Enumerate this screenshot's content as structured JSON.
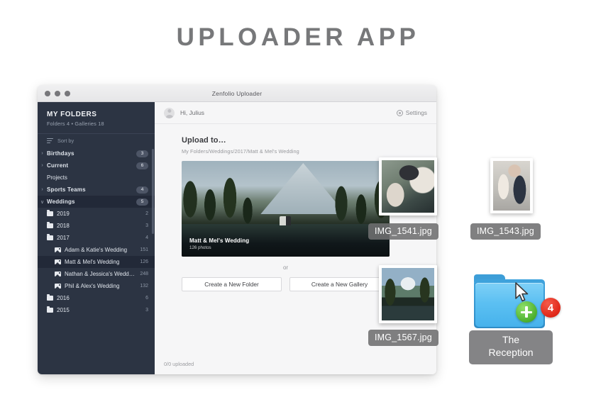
{
  "page": {
    "title": "UPLOADER APP"
  },
  "window": {
    "title": "Zenfolio Uploader",
    "traffic_lights": [
      "close-dot",
      "minimize-dot",
      "zoom-dot"
    ]
  },
  "sidebar": {
    "heading": "MY FOLDERS",
    "subheading": "Folders 4  •  Galleries 18",
    "sort_label": "Sort by",
    "tree": [
      {
        "label": "Birthdays",
        "count": "3",
        "type": "group",
        "expander": "›",
        "indent": 0,
        "selected": false,
        "clipped": true
      },
      {
        "label": "Current Projects",
        "count": "6",
        "type": "group",
        "expander": "›",
        "indent": 0,
        "selected": false
      },
      {
        "label": "Sports Teams",
        "count": "4",
        "type": "group",
        "expander": "›",
        "indent": 0,
        "selected": false
      },
      {
        "label": "Weddings",
        "count": "5",
        "type": "group",
        "expander": "∨",
        "indent": 0,
        "selected": true
      },
      {
        "label": "2019",
        "count": "2",
        "type": "folder",
        "indent": 1,
        "selected": false
      },
      {
        "label": "2018",
        "count": "3",
        "type": "folder",
        "indent": 1,
        "selected": false
      },
      {
        "label": "2017",
        "count": "4",
        "type": "folder",
        "indent": 1,
        "selected": false
      },
      {
        "label": "Adam & Katie's Wedding",
        "count": "151",
        "type": "gallery",
        "indent": 2,
        "selected": false
      },
      {
        "label": "Matt & Mel's Wedding",
        "count": "126",
        "type": "gallery",
        "indent": 2,
        "selected": true
      },
      {
        "label": "Nathan & Jessica's Wedd…",
        "count": "248",
        "type": "gallery",
        "indent": 2,
        "selected": false
      },
      {
        "label": "Phil & Alex's Wedding",
        "count": "132",
        "type": "gallery",
        "indent": 2,
        "selected": false
      },
      {
        "label": "2016",
        "count": "6",
        "type": "folder",
        "indent": 1,
        "selected": false
      },
      {
        "label": "2015",
        "count": "3",
        "type": "folder",
        "indent": 1,
        "selected": false
      }
    ]
  },
  "main": {
    "greeting": "Hi, Julius",
    "settings_label": "Settings",
    "upload_heading": "Upload to…",
    "breadcrumb": "My Folders/Weddings/2017/Matt & Mel's Wedding",
    "hero": {
      "title": "Matt & Mel's Wedding",
      "subtitle": "126 photos"
    },
    "or_label": "or",
    "new_folder_button": "Create a New Folder",
    "new_gallery_button": "Create a New Gallery",
    "status": "0/0 uploaded"
  },
  "dragged_items": {
    "photos": [
      {
        "filename": "IMG_1541.jpg"
      },
      {
        "filename": "IMG_1543.jpg"
      },
      {
        "filename": "IMG_1567.jpg"
      }
    ],
    "folder": {
      "name_line1": "The",
      "name_line2": "Reception",
      "badge_count": "4"
    }
  },
  "colors": {
    "sidebar_bg": "#2c3443",
    "sidebar_selected": "#222938",
    "panel_bg": "#f6f6f7",
    "title_gray": "#77787a",
    "folder_blue": "#5cc0f2",
    "badge_red": "#e02718",
    "plus_green": "#4caf2e",
    "label_gray": "#6e6e70"
  }
}
